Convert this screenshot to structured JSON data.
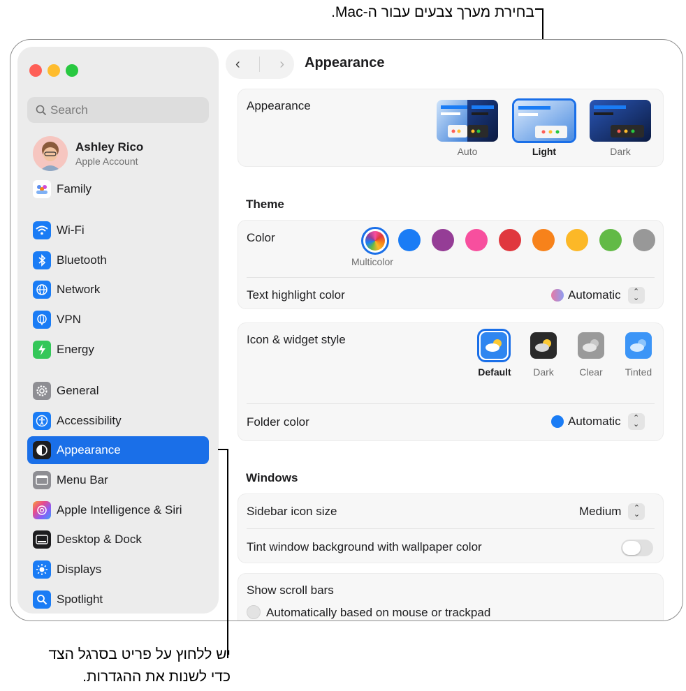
{
  "callouts": {
    "top": "בחירת מערך צבעים עבור ה-Mac.",
    "bottom_line1": "יש ללחוץ על פריט בסרגל הצד",
    "bottom_line2": "כדי לשנות את ההגדרות."
  },
  "window": {
    "title": "Appearance",
    "back_glyph": "‹",
    "forward_glyph": "›"
  },
  "sidebar": {
    "search_placeholder": "Search",
    "account": {
      "name": "Ashley Rico",
      "subtitle": "Apple Account"
    },
    "items": [
      {
        "label": "Family",
        "icon": "family-icon",
        "color": "#ffffff"
      },
      {
        "label": "Wi-Fi",
        "icon": "wifi-icon",
        "color": "#1a7cf5"
      },
      {
        "label": "Bluetooth",
        "icon": "bluetooth-icon",
        "color": "#1a7cf5"
      },
      {
        "label": "Network",
        "icon": "network-icon",
        "color": "#1a7cf5"
      },
      {
        "label": "VPN",
        "icon": "vpn-icon",
        "color": "#1a7cf5"
      },
      {
        "label": "Energy",
        "icon": "energy-icon",
        "color": "#34c759"
      },
      {
        "label": "General",
        "icon": "gear-icon",
        "color": "#8e8e93"
      },
      {
        "label": "Accessibility",
        "icon": "accessibility-icon",
        "color": "#1a7cf5"
      },
      {
        "label": "Appearance",
        "icon": "appearance-icon",
        "color": "#1d1d1f",
        "active": true
      },
      {
        "label": "Menu Bar",
        "icon": "menu-bar-icon",
        "color": "#8e8e93"
      },
      {
        "label": "Apple Intelligence & Siri",
        "icon": "siri-icon",
        "color": "#d14bd8"
      },
      {
        "label": "Desktop & Dock",
        "icon": "dock-icon",
        "color": "#1d1d1f"
      },
      {
        "label": "Displays",
        "icon": "displays-icon",
        "color": "#1a7cf5"
      },
      {
        "label": "Spotlight",
        "icon": "spotlight-icon",
        "color": "#1a7cf5"
      }
    ]
  },
  "appearance": {
    "label": "Appearance",
    "options": [
      "Auto",
      "Light",
      "Dark"
    ],
    "selected": "Light"
  },
  "theme": {
    "heading": "Theme",
    "color_label": "Color",
    "multicolor_label": "Multicolor",
    "accent_colors": [
      "#1a7cf5",
      "#953d96",
      "#f74f9e",
      "#e0383e",
      "#f7821b",
      "#fcb827",
      "#62ba46",
      "#989898"
    ],
    "highlight_label": "Text highlight color",
    "highlight_value": "Automatic",
    "icon_style_label": "Icon & widget style",
    "icon_styles": [
      "Default",
      "Dark",
      "Clear",
      "Tinted"
    ],
    "icon_style_selected": "Default",
    "folder_label": "Folder color",
    "folder_value": "Automatic",
    "accent": "#1a6fe8"
  },
  "windows": {
    "heading": "Windows",
    "sidebar_icon_size_label": "Sidebar icon size",
    "sidebar_icon_size_value": "Medium",
    "tint_label": "Tint window background with wallpaper color",
    "tint_on": false,
    "scroll_bars_label": "Show scroll bars",
    "scroll_bars_option": "Automatically based on mouse or trackpad"
  }
}
